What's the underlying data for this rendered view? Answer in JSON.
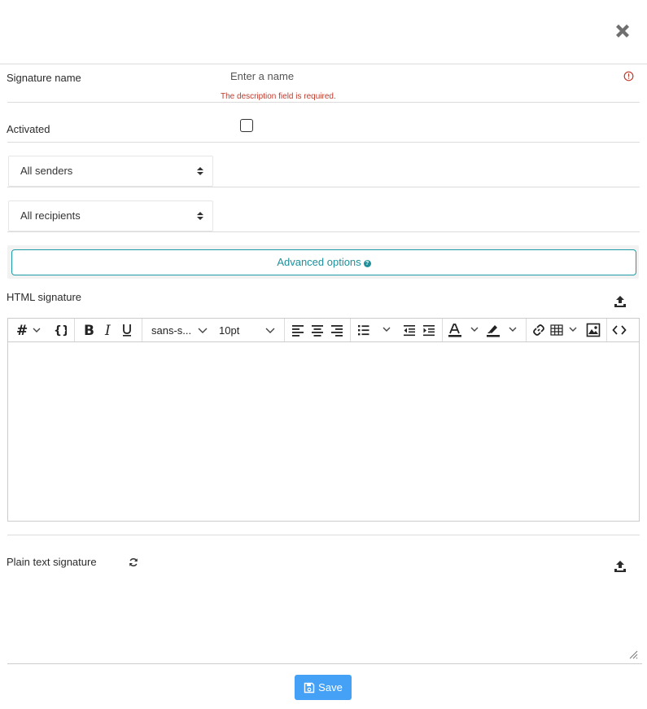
{
  "form": {
    "signature_name_label": "Signature name",
    "signature_name_placeholder": "Enter a name",
    "signature_name_value": "",
    "error_message": "The description field is required.",
    "activated_label": "Activated",
    "activated_checked": false,
    "senders_select": {
      "selected": "All senders"
    },
    "recipients_select": {
      "selected": "All recipients"
    },
    "advanced_options_label": "Advanced options",
    "html_signature_label": "HTML signature",
    "plain_text_signature_label": "Plain text signature",
    "plain_text_value": "",
    "save_label": "Save"
  },
  "editor_toolbar": {
    "font_family": "sans-s...",
    "font_size": "10pt",
    "tools": [
      "heading",
      "code-braces",
      "bold",
      "italic",
      "underline",
      "font-family",
      "font-size",
      "align-left",
      "align-center",
      "align-right",
      "bullet-list",
      "outdent",
      "indent",
      "text-color",
      "highlight",
      "link",
      "table",
      "image",
      "source-code"
    ]
  },
  "icons": {
    "close": "close-icon",
    "error": "error-icon",
    "upload": "upload-icon",
    "refresh": "refresh-icon",
    "save": "floppy-disk-icon",
    "help": "question-circle-icon"
  },
  "colors": {
    "accent_teal": "#1f8f9a",
    "error_red": "#c0392b",
    "save_blue": "#45a1f5",
    "close_gray": "#6f6f6f"
  }
}
